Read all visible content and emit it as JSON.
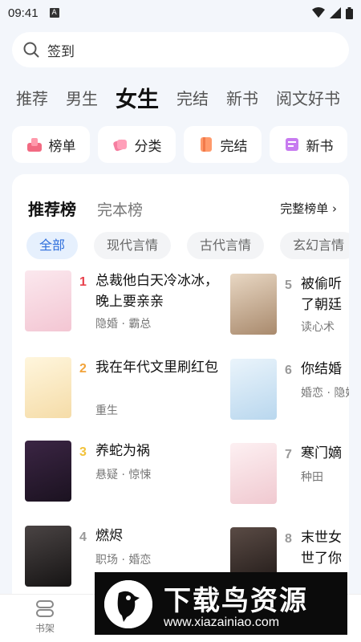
{
  "status": {
    "time": "09:41",
    "a_badge": "A"
  },
  "search": {
    "placeholder": "签到"
  },
  "tabs": [
    {
      "label": "推荐",
      "active": false
    },
    {
      "label": "男生",
      "active": false
    },
    {
      "label": "女生",
      "active": true
    },
    {
      "label": "完结",
      "active": false
    },
    {
      "label": "新书",
      "active": false
    },
    {
      "label": "阅文好书",
      "active": false
    }
  ],
  "chips": [
    {
      "label": "榜单",
      "icon": "ranking-icon"
    },
    {
      "label": "分类",
      "icon": "category-icon"
    },
    {
      "label": "完结",
      "icon": "finished-icon"
    },
    {
      "label": "新书",
      "icon": "new-book-icon"
    }
  ],
  "ranking": {
    "title": "推荐榜",
    "subtitle": "完本榜",
    "more": "完整榜单 ›",
    "filters": [
      {
        "label": "全部",
        "active": true
      },
      {
        "label": "现代言情",
        "active": false
      },
      {
        "label": "古代言情",
        "active": false
      },
      {
        "label": "玄幻言情",
        "active": false
      }
    ],
    "books": [
      {
        "rank": "1",
        "name": "总裁他白天冷冰冰，晚上要亲亲",
        "tags": "隐婚 · 霸总",
        "rank_color": "#e8414c",
        "cover": "#f6dfe6"
      },
      {
        "rank": "2",
        "name": "我在年代文里刷红包",
        "tags": "重生",
        "rank_color": "#f2a33a",
        "cover": "#fbf1d6"
      },
      {
        "rank": "3",
        "name": "养蛇为祸",
        "tags": "悬疑 · 惊悚",
        "rank_color": "#f2c23a",
        "cover": "#2a1b2f"
      },
      {
        "rank": "4",
        "name": "燃烬",
        "tags": "职场 · 婚恋",
        "rank_color": "#999999",
        "cover": "#2c2a2a"
      },
      {
        "rank": "5",
        "name": "被偷听心声后，我成了朝廷团宠",
        "tags": "读心术",
        "rank_color": "#999999",
        "cover": "#cfb9a2"
      },
      {
        "rank": "6",
        "name": "你结婚，我离婚",
        "tags": "婚恋 · 隐婚",
        "rank_color": "#999999",
        "cover": "#cfe3f2"
      },
      {
        "rank": "7",
        "name": "寒门嫡女",
        "tags": "种田",
        "rank_color": "#999999",
        "cover": "#f7e7ea"
      },
      {
        "rank": "8",
        "name": "末世女穿越，世了你去",
        "tags": "",
        "rank_color": "#999999",
        "cover": "#3a2f2c"
      }
    ],
    "visible_names": [
      "总裁他白天冷冰冰，晚上要亲亲",
      "我在年代文里刷红包",
      "养蛇为祸",
      "燃烬",
      "被偷听",
      "了朝廷",
      "你结婚",
      "寒门嫡",
      "末世女",
      "世了你"
    ]
  },
  "bottom_nav": [
    {
      "label": "书架",
      "icon": "bookshelf-icon"
    }
  ],
  "watermark": {
    "title": "下载鸟资源",
    "url": "www.xiazainiao.com"
  }
}
